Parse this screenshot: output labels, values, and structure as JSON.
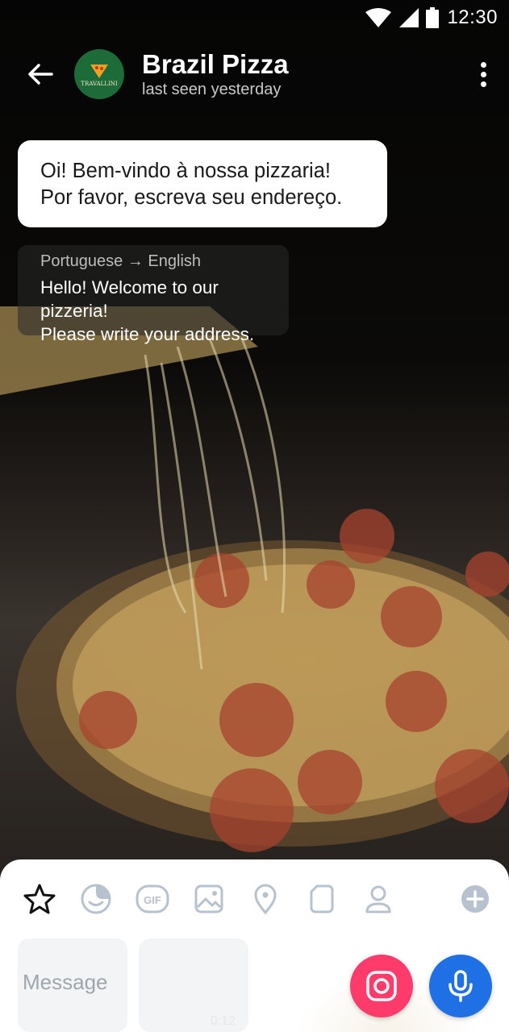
{
  "status_bar": {
    "time": "12:30"
  },
  "header": {
    "back_icon": "arrow-left-icon",
    "avatar_text": "TRAVALLINI",
    "title": "Brazil Pizza",
    "subtitle": "last seen yesterday",
    "menu_icon": "more-vertical-icon"
  },
  "messages": {
    "incoming_line1": "Oi! Bem-vindo à nossa pizzaria!",
    "incoming_line2": "Por favor, escreva seu endereço.",
    "translation_lang": "Portuguese → English",
    "translation_line1": "Hello! Welcome to our pizzeria!",
    "translation_line2": "Please write your address."
  },
  "attachment_tabs": [
    {
      "icon": "star-icon",
      "active": true
    },
    {
      "icon": "sticker-icon"
    },
    {
      "icon": "gif-icon",
      "label": "GIF"
    },
    {
      "icon": "image-icon"
    },
    {
      "icon": "location-pin-icon"
    },
    {
      "icon": "file-icon"
    },
    {
      "icon": "contact-icon"
    },
    {
      "icon": "add-circle-icon"
    }
  ],
  "input": {
    "placeholder": "Message",
    "video_duration": "0:12"
  },
  "colors": {
    "camera_button": "#ff3b6b",
    "mic_button": "#1f6fe5",
    "tab_icon": "#b8c2cf"
  }
}
